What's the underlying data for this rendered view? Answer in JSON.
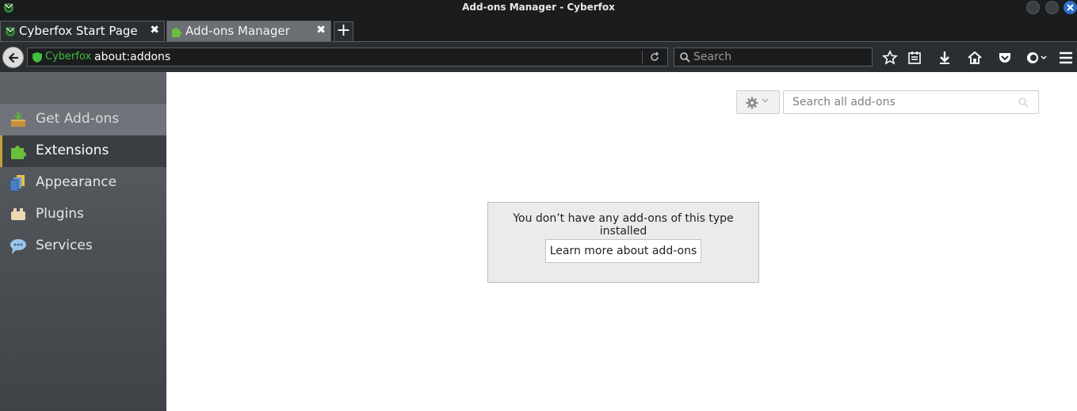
{
  "window": {
    "title": "Add-ons Manager - Cyberfox"
  },
  "tabs": [
    {
      "label": "Cyberfox Start Page",
      "icon": "cyberfox-icon",
      "close": "✖"
    },
    {
      "label": "Add-ons Manager",
      "icon": "puzzle-icon",
      "close": "✖"
    }
  ],
  "newtab_label": "+",
  "navbar": {
    "identity_label": "Cyberfox",
    "url": "about:addons",
    "search_placeholder": "Search"
  },
  "sidebar": {
    "items": [
      {
        "label": "Get Add-ons",
        "icon": "get-addons-icon"
      },
      {
        "label": "Extensions",
        "icon": "puzzle-icon",
        "selected": true
      },
      {
        "label": "Appearance",
        "icon": "appearance-icon"
      },
      {
        "label": "Plugins",
        "icon": "plugin-icon"
      },
      {
        "label": "Services",
        "icon": "services-icon"
      }
    ]
  },
  "main": {
    "search_placeholder": "Search all add-ons",
    "empty_message": "You don’t have any add-ons of this type installed",
    "learn_more_label": "Learn more about add-ons"
  },
  "colors": {
    "chrome_dark": "#1a1c1e",
    "toolbar": "#2b2e31",
    "sidebar_selected_accent": "#c7a23a",
    "identity_green": "#3fbf3f",
    "close_button_blue": "#2f6fc9"
  }
}
